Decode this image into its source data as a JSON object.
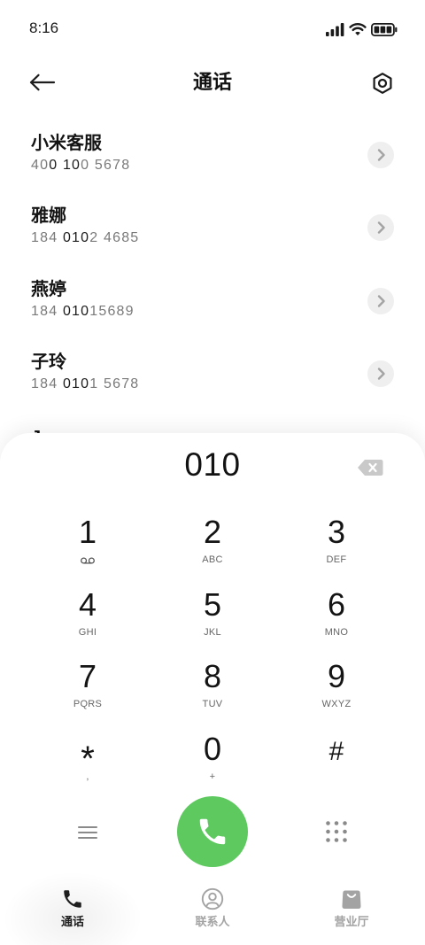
{
  "status_bar": {
    "time": "8:16",
    "icons": [
      "signal-icon",
      "wifi-icon",
      "battery-icon"
    ]
  },
  "header": {
    "title": "通话",
    "back_icon": "back-arrow-icon",
    "settings_icon": "settings-icon"
  },
  "contacts": [
    {
      "name": "小米客服",
      "number_parts": [
        {
          "text": "40",
          "matched": false
        },
        {
          "text": "0 10",
          "matched": true
        },
        {
          "text": "0 5678",
          "matched": false
        }
      ]
    },
    {
      "name": "雅娜",
      "number_parts": [
        {
          "text": "184 ",
          "matched": false
        },
        {
          "text": "010",
          "matched": true
        },
        {
          "text": "2 4685",
          "matched": false
        }
      ]
    },
    {
      "name": "燕婷",
      "number_parts": [
        {
          "text": "184 ",
          "matched": false
        },
        {
          "text": "010",
          "matched": true
        },
        {
          "text": "15689",
          "matched": false
        }
      ]
    },
    {
      "name": "子玲",
      "number_parts": [
        {
          "text": "184 ",
          "matched": false
        },
        {
          "text": "010",
          "matched": true
        },
        {
          "text": "1 5678",
          "matched": false
        }
      ]
    },
    {
      "name": "Jason"
    }
  ],
  "dialer": {
    "input": "010",
    "backspace_icon": "backspace-icon",
    "keys": [
      {
        "digit": "1",
        "sub_icon": "voicemail-icon"
      },
      {
        "digit": "2",
        "sub": "ABC"
      },
      {
        "digit": "3",
        "sub": "DEF"
      },
      {
        "digit": "4",
        "sub": "GHI"
      },
      {
        "digit": "5",
        "sub": "JKL"
      },
      {
        "digit": "6",
        "sub": "MNO"
      },
      {
        "digit": "7",
        "sub": "PQRS"
      },
      {
        "digit": "8",
        "sub": "TUV"
      },
      {
        "digit": "9",
        "sub": "WXYZ"
      },
      {
        "digit": "*",
        "sub": ","
      },
      {
        "digit": "0",
        "sub": "+"
      },
      {
        "digit": "#"
      }
    ],
    "actions": {
      "menu_icon": "menu-icon",
      "call_icon": "call-icon",
      "dialpad_icon": "dialpad-icon"
    }
  },
  "nav": {
    "tabs": [
      {
        "label": "通话",
        "icon": "phone-icon",
        "active": true
      },
      {
        "label": "联系人",
        "icon": "contacts-icon",
        "active": false
      },
      {
        "label": "营业厅",
        "icon": "store-bag-icon",
        "active": false
      }
    ]
  },
  "colors": {
    "call_button": "#5dc95f",
    "number_match": "#1c1c1c",
    "number_muted": "#7a7a7a",
    "nav_active": "#1e1e1e",
    "nav_inactive": "#a3a3a3"
  }
}
